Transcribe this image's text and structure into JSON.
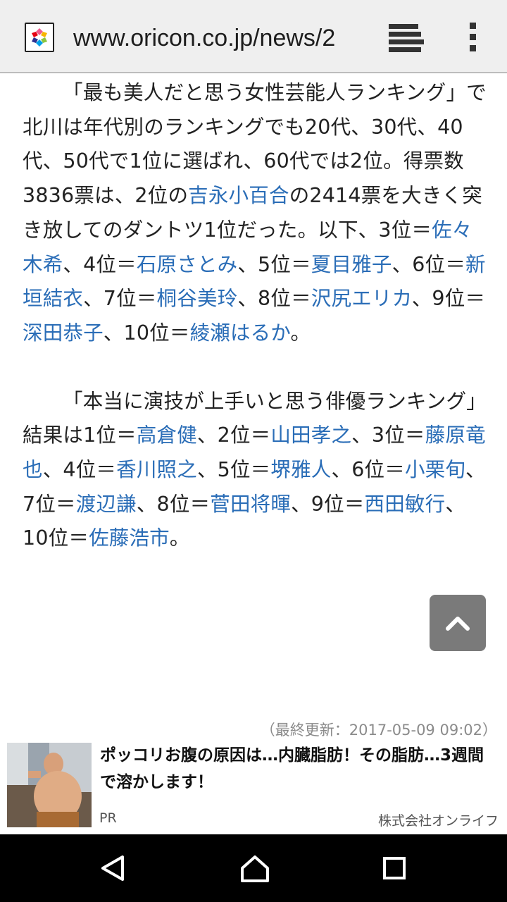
{
  "browser": {
    "url": "www.oricon.co.jp/news/2"
  },
  "article": {
    "para1": [
      {
        "text": "「最も美人だと思う女性芸能人ランキング」で北川は年代別のランキングでも20代、30代、40代、50代で1位に選ばれ、60代では2位。得票数3836票は、2位の"
      },
      {
        "text": "吉永小百合",
        "link": true
      },
      {
        "text": "の2414票を大きく突き放してのダントツ1位だった。以下、3位＝"
      },
      {
        "text": "佐々木希",
        "link": true
      },
      {
        "text": "、4位＝"
      },
      {
        "text": "石原さとみ",
        "link": true
      },
      {
        "text": "、5位＝"
      },
      {
        "text": "夏目雅子",
        "link": true
      },
      {
        "text": "、6位＝"
      },
      {
        "text": "新垣結衣",
        "link": true
      },
      {
        "text": "、7位＝"
      },
      {
        "text": "桐谷美玲",
        "link": true
      },
      {
        "text": "、8位＝"
      },
      {
        "text": "沢尻エリカ",
        "link": true
      },
      {
        "text": "、9位＝"
      },
      {
        "text": "深田恭子",
        "link": true
      },
      {
        "text": "、10位＝"
      },
      {
        "text": "綾瀬はるか",
        "link": true
      },
      {
        "text": "。"
      }
    ],
    "para2": [
      {
        "text": "「本当に演技が上手いと思う俳優ランキング」結果は1位＝"
      },
      {
        "text": "高倉健",
        "link": true
      },
      {
        "text": "、2位＝"
      },
      {
        "text": "山田孝之",
        "link": true
      },
      {
        "text": "、3位＝"
      },
      {
        "text": "藤原竜也",
        "link": true
      },
      {
        "text": "、4位＝"
      },
      {
        "text": "香川照之",
        "link": true
      },
      {
        "text": "、5位＝"
      },
      {
        "text": "堺雅人",
        "link": true
      },
      {
        "text": "、6位＝"
      },
      {
        "text": "小栗旬",
        "link": true
      },
      {
        "text": "、7位＝"
      },
      {
        "text": "渡辺謙",
        "link": true
      },
      {
        "text": "、8位＝"
      },
      {
        "text": "菅田将暉",
        "link": true
      },
      {
        "text": "、9位＝"
      },
      {
        "text": "西田敏行",
        "link": true
      },
      {
        "text": "、10位＝"
      },
      {
        "text": "佐藤浩市",
        "link": true
      },
      {
        "text": "。"
      }
    ],
    "updated": "（最終更新：2017-05-09 09:02）"
  },
  "ad": {
    "title": "ポッコリお腹の原因は…内臓脂肪！その脂肪…3週間で溶かします！",
    "pr_label": "PR",
    "sponsor": "株式会社オンライフ"
  },
  "icons": {
    "favicon": "oricon-favicon-icon",
    "tabs": "tabs-icon",
    "menu": "overflow-menu-icon",
    "to_top": "chevron-up-icon",
    "back": "back-triangle-icon",
    "home": "home-icon",
    "recent": "recent-apps-icon"
  },
  "colors": {
    "link": "#2a6db7",
    "toolbar_bg": "#efefef",
    "to_top_bg": "#7a7a7a",
    "nav_bg": "#000000"
  }
}
